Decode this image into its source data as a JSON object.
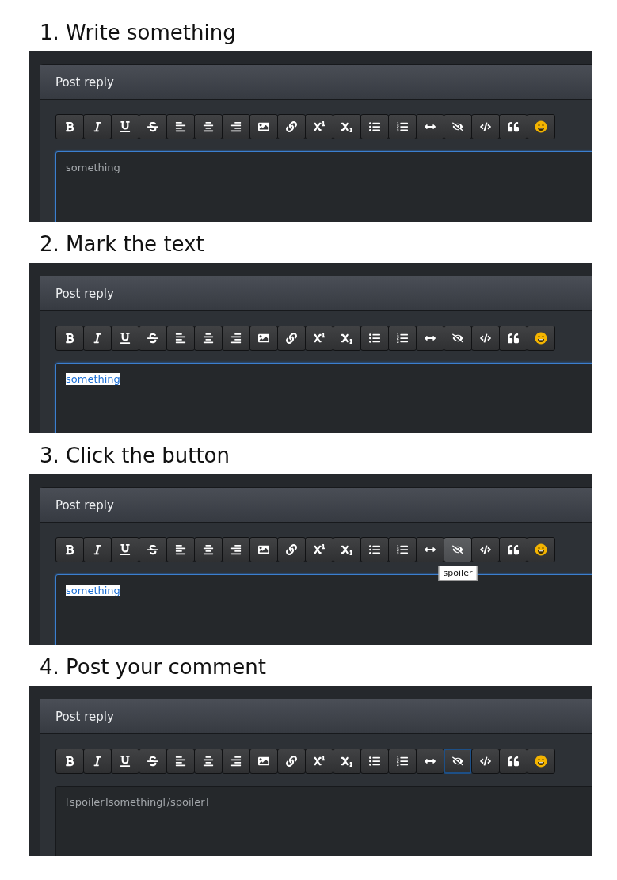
{
  "steps": [
    {
      "title": "1. Write something",
      "editor": {
        "header": "Post reply",
        "focused": true,
        "text": "something",
        "text_selected": false
      },
      "toolbar": [
        {
          "hovered": false,
          "pressed": false
        },
        {
          "hovered": false,
          "pressed": false
        },
        {
          "hovered": false,
          "pressed": false
        },
        {
          "hovered": false,
          "pressed": false
        },
        {
          "hovered": false,
          "pressed": false
        },
        {
          "hovered": false,
          "pressed": false
        },
        {
          "hovered": false,
          "pressed": false
        },
        {
          "hovered": false,
          "pressed": false
        },
        {
          "hovered": false,
          "pressed": false
        },
        {
          "hovered": false,
          "pressed": false
        },
        {
          "hovered": false,
          "pressed": false
        },
        {
          "hovered": false,
          "pressed": false
        },
        {
          "hovered": false,
          "pressed": false
        },
        {
          "hovered": false,
          "pressed": false
        },
        {
          "hovered": false,
          "pressed": false
        },
        {
          "hovered": false,
          "pressed": false
        },
        {
          "hovered": false,
          "pressed": false
        },
        {
          "hovered": false,
          "pressed": false
        }
      ]
    },
    {
      "title": "2. Mark the text",
      "editor": {
        "header": "Post reply",
        "focused": true,
        "text": "something",
        "text_selected": true
      },
      "toolbar": [
        {
          "hovered": false,
          "pressed": false
        },
        {
          "hovered": false,
          "pressed": false
        },
        {
          "hovered": false,
          "pressed": false
        },
        {
          "hovered": false,
          "pressed": false
        },
        {
          "hovered": false,
          "pressed": false
        },
        {
          "hovered": false,
          "pressed": false
        },
        {
          "hovered": false,
          "pressed": false
        },
        {
          "hovered": false,
          "pressed": false
        },
        {
          "hovered": false,
          "pressed": false
        },
        {
          "hovered": false,
          "pressed": false
        },
        {
          "hovered": false,
          "pressed": false
        },
        {
          "hovered": false,
          "pressed": false
        },
        {
          "hovered": false,
          "pressed": false
        },
        {
          "hovered": false,
          "pressed": false
        },
        {
          "hovered": false,
          "pressed": false
        },
        {
          "hovered": false,
          "pressed": false
        },
        {
          "hovered": false,
          "pressed": false
        },
        {
          "hovered": false,
          "pressed": false
        }
      ]
    },
    {
      "title": "3. Click the button",
      "editor": {
        "header": "Post reply",
        "focused": true,
        "text": "something",
        "text_selected": true
      },
      "toolbar": [
        {
          "hovered": false,
          "pressed": false
        },
        {
          "hovered": false,
          "pressed": false
        },
        {
          "hovered": false,
          "pressed": false
        },
        {
          "hovered": false,
          "pressed": false
        },
        {
          "hovered": false,
          "pressed": false
        },
        {
          "hovered": false,
          "pressed": false
        },
        {
          "hovered": false,
          "pressed": false
        },
        {
          "hovered": false,
          "pressed": false
        },
        {
          "hovered": false,
          "pressed": false
        },
        {
          "hovered": false,
          "pressed": false
        },
        {
          "hovered": false,
          "pressed": false
        },
        {
          "hovered": false,
          "pressed": false
        },
        {
          "hovered": false,
          "pressed": false
        },
        {
          "hovered": false,
          "pressed": false
        },
        {
          "hovered": true,
          "pressed": false,
          "tooltip": "spoiler"
        },
        {
          "hovered": false,
          "pressed": false
        },
        {
          "hovered": false,
          "pressed": false
        },
        {
          "hovered": false,
          "pressed": false
        }
      ]
    },
    {
      "title": "4. Post your comment",
      "editor": {
        "header": "Post reply",
        "focused": false,
        "text": "[spoiler]something[/spoiler]",
        "text_selected": false
      },
      "toolbar": [
        {
          "hovered": false,
          "pressed": false
        },
        {
          "hovered": false,
          "pressed": false
        },
        {
          "hovered": false,
          "pressed": false
        },
        {
          "hovered": false,
          "pressed": false
        },
        {
          "hovered": false,
          "pressed": false
        },
        {
          "hovered": false,
          "pressed": false
        },
        {
          "hovered": false,
          "pressed": false
        },
        {
          "hovered": false,
          "pressed": false
        },
        {
          "hovered": false,
          "pressed": false
        },
        {
          "hovered": false,
          "pressed": false
        },
        {
          "hovered": false,
          "pressed": false
        },
        {
          "hovered": false,
          "pressed": false
        },
        {
          "hovered": false,
          "pressed": false
        },
        {
          "hovered": false,
          "pressed": false
        },
        {
          "hovered": false,
          "pressed": true
        },
        {
          "hovered": false,
          "pressed": false
        },
        {
          "hovered": false,
          "pressed": false
        },
        {
          "hovered": false,
          "pressed": false
        }
      ]
    }
  ]
}
